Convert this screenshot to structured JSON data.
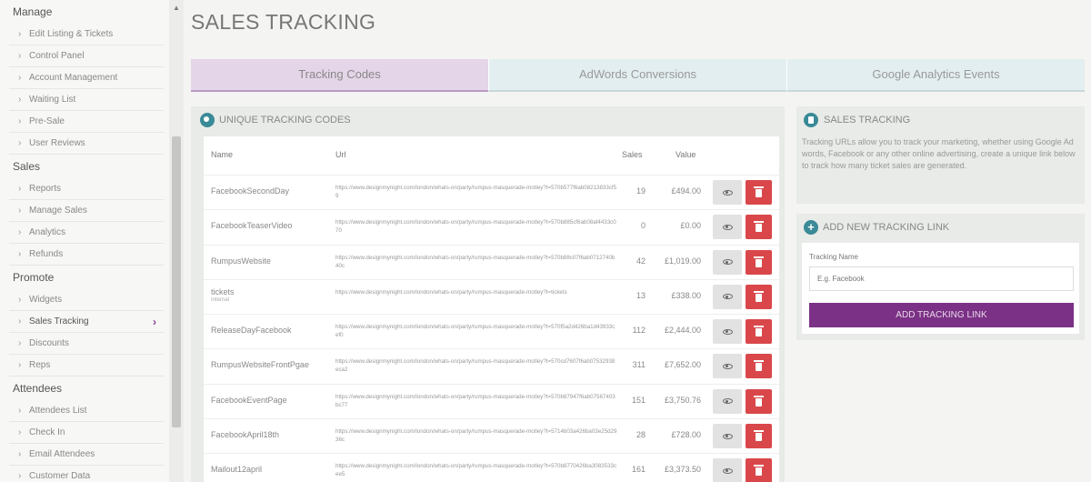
{
  "sidebar": {
    "sections": [
      {
        "title": "Manage",
        "items": [
          "Edit Listing & Tickets",
          "Control Panel",
          "Account Management",
          "Waiting List",
          "Pre-Sale",
          "User Reviews"
        ]
      },
      {
        "title": "Sales",
        "items": [
          "Reports",
          "Manage Sales",
          "Analytics",
          "Refunds"
        ]
      },
      {
        "title": "Promote",
        "items": [
          "Widgets",
          "Sales Tracking",
          "Discounts",
          "Reps"
        ]
      },
      {
        "title": "Attendees",
        "items": [
          "Attendees List",
          "Check In",
          "Email Attendees",
          "Customer Data"
        ]
      }
    ]
  },
  "page": {
    "title": "SALES TRACKING"
  },
  "tabs": [
    {
      "label": "Tracking Codes"
    },
    {
      "label": "AdWords Conversions"
    },
    {
      "label": "Google Analytics Events"
    }
  ],
  "codes_panel": {
    "title": "UNIQUE TRACKING CODES",
    "columns": {
      "name": "Name",
      "url": "Url",
      "sales": "Sales",
      "value": "Value"
    },
    "rows": [
      {
        "name": "FacebookSecondDay",
        "sub": "",
        "url": "https://www.designmynight.com/london/whats-on/party/rumpus-masquerade-motley?t=570b577f6ab08213833cf59",
        "sales": "19",
        "value": "£494.00"
      },
      {
        "name": "FacebookTeaserVideo",
        "sub": "",
        "url": "https://www.designmynight.com/london/whats-on/party/rumpus-masquerade-motley?t=570b885cf6ab08af4433c070",
        "sales": "0",
        "value": "£0.00"
      },
      {
        "name": "RumpusWebsite",
        "sub": "",
        "url": "https://www.designmynight.com/london/whats-on/party/rumpus-masquerade-motley?t=570b88c07f6ab0712740b40c",
        "sales": "42",
        "value": "£1,019.00"
      },
      {
        "name": "tickets",
        "sub": "Internal",
        "url": "https://www.designmynight.com/london/whats-on/party/rumpus-masquerade-motley?t=tickets",
        "sales": "13",
        "value": "£338.00"
      },
      {
        "name": "ReleaseDayFacebook",
        "sub": "",
        "url": "https://www.designmynight.com/london/whats-on/party/rumpus-masquerade-motley?t=570f5a2d426ba1d43933cef0",
        "sales": "112",
        "value": "£2,444.00"
      },
      {
        "name": "RumpusWebsiteFrontPgae",
        "sub": "",
        "url": "https://www.designmynight.com/london/whats-on/party/rumpus-masquerade-motley?t=570cd7607f6ab07532938eca2",
        "sales": "311",
        "value": "£7,652.00"
      },
      {
        "name": "FacebookEventPage",
        "sub": "",
        "url": "https://www.designmynight.com/london/whats-on/party/rumpus-masquerade-motley?t=570b87947f6ab07567403bc77",
        "sales": "151",
        "value": "£3,750.76"
      },
      {
        "name": "FacebookApril18th",
        "sub": "",
        "url": "https://www.designmynight.com/london/whats-on/party/rumpus-masquerade-motley?t=5714b03a426ba03e25d2936c",
        "sales": "28",
        "value": "£728.00"
      },
      {
        "name": "Mailout12april",
        "sub": "",
        "url": "https://www.designmynight.com/london/whats-on/party/rumpus-masquerade-motley?t=570b8770426ba3083533cee5",
        "sales": "161",
        "value": "£3,373.50"
      }
    ]
  },
  "info_panel": {
    "title": "SALES TRACKING",
    "text": "Tracking URLs allow you to track your marketing, whether using Google Ad words, Facebook or any other online advertising, create a unique link below to track how many ticket sales are generated."
  },
  "add_panel": {
    "title": "ADD NEW TRACKING LINK",
    "field_label": "Tracking Name",
    "placeholder": "E.g. Facebook",
    "button": "ADD TRACKING LINK"
  },
  "colors": {
    "accent_purple": "#7b3185",
    "teal_icon": "#3a8a97",
    "delete_red": "#d9474a"
  }
}
